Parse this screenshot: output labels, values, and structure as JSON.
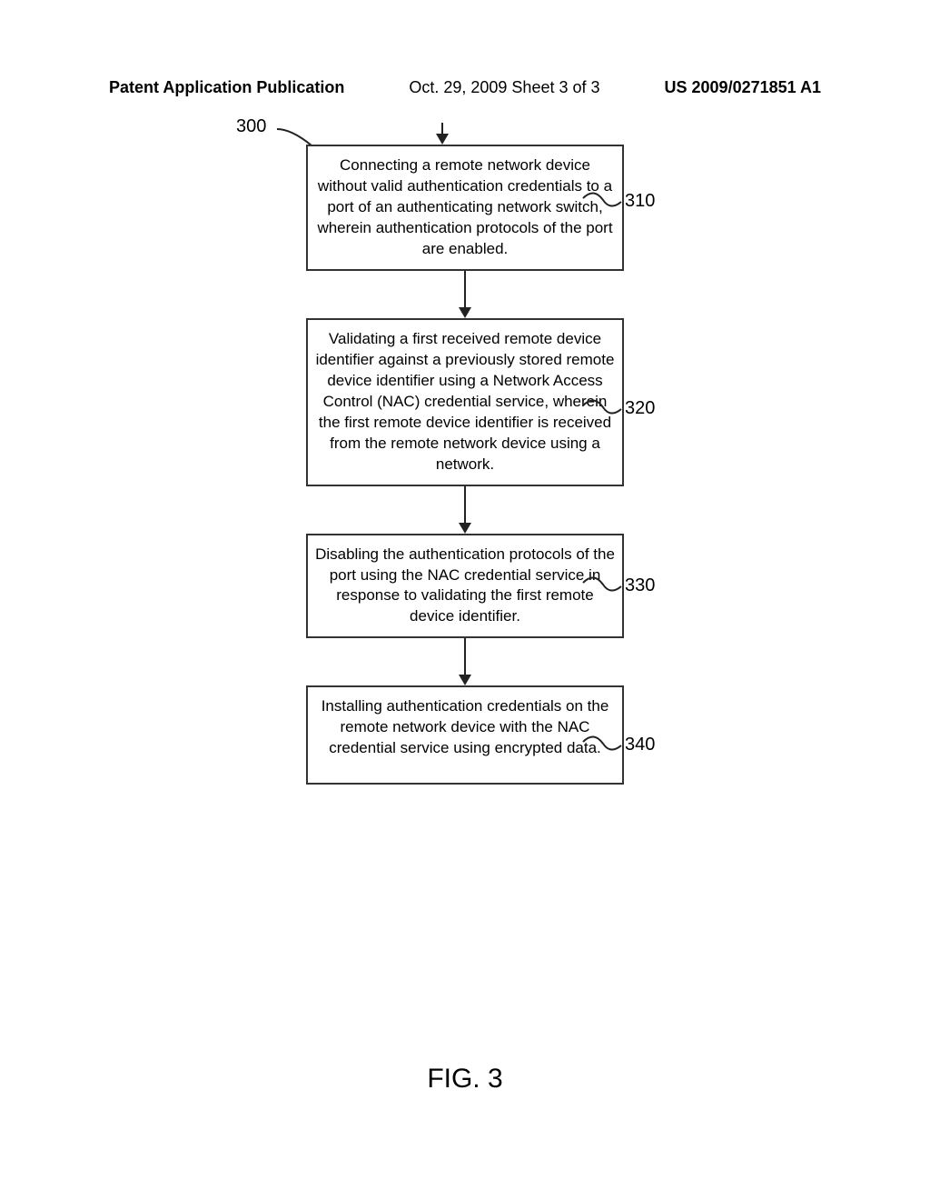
{
  "header": {
    "left": "Patent Application Publication",
    "center": "Oct. 29, 2009   Sheet 3 of 3",
    "right": "US 2009/0271851 A1"
  },
  "refs": {
    "r300": "300",
    "r310": "310",
    "r320": "320",
    "r330": "330",
    "r340": "340"
  },
  "steps": {
    "s310": "Connecting a remote network device without valid authentication credentials to a port of an authenticating network switch, wherein authentication protocols of the port are enabled.",
    "s320": "Validating a first received remote device identifier against a previously stored remote device identifier using a Network Access Control (NAC) credential service, wherein the first remote device identifier is received from the remote network device using a network.",
    "s330": "Disabling the authentication protocols of the port using the NAC credential service in response to validating the first remote device identifier.",
    "s340": "Installing authentication credentials on the remote network device with the NAC credential service using encrypted data."
  },
  "figure_label": "FIG. 3"
}
